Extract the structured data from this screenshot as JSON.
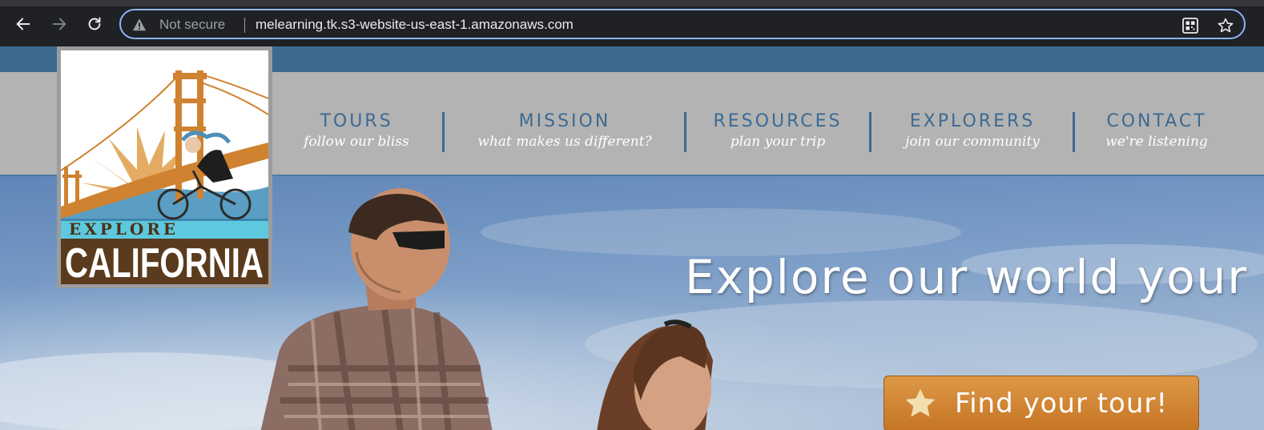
{
  "browser": {
    "security_label": "Not secure",
    "url": "melearning.tk.s3-website-us-east-1.amazonaws.com",
    "icons": [
      "back-arrow-icon",
      "forward-arrow-icon",
      "reload-icon",
      "warning-icon",
      "qr-code-icon",
      "bookmark-star-icon"
    ]
  },
  "site": {
    "logo": {
      "top_text": "EXPLORE",
      "bottom_text": "CALIFORNIA"
    },
    "nav": [
      {
        "title": "TOURS",
        "subtitle": "follow our bliss"
      },
      {
        "title": "MISSION",
        "subtitle": "what makes us different?"
      },
      {
        "title": "RESOURCES",
        "subtitle": "plan your trip"
      },
      {
        "title": "EXPLORERS",
        "subtitle": "join our community"
      },
      {
        "title": "CONTACT",
        "subtitle": "we're listening"
      }
    ],
    "hero": {
      "headline": "Explore our world your way",
      "cta_label": "Find your tour!"
    }
  },
  "colors": {
    "topbar": "#3e6a8e",
    "nav_bg": "#b3b3b3",
    "nav_title": "#3c6a93",
    "cta": "#d48a37",
    "logo_brown": "#5a3b1d",
    "logo_orange": "#cf8230",
    "logo_teal": "#5ec9de"
  }
}
